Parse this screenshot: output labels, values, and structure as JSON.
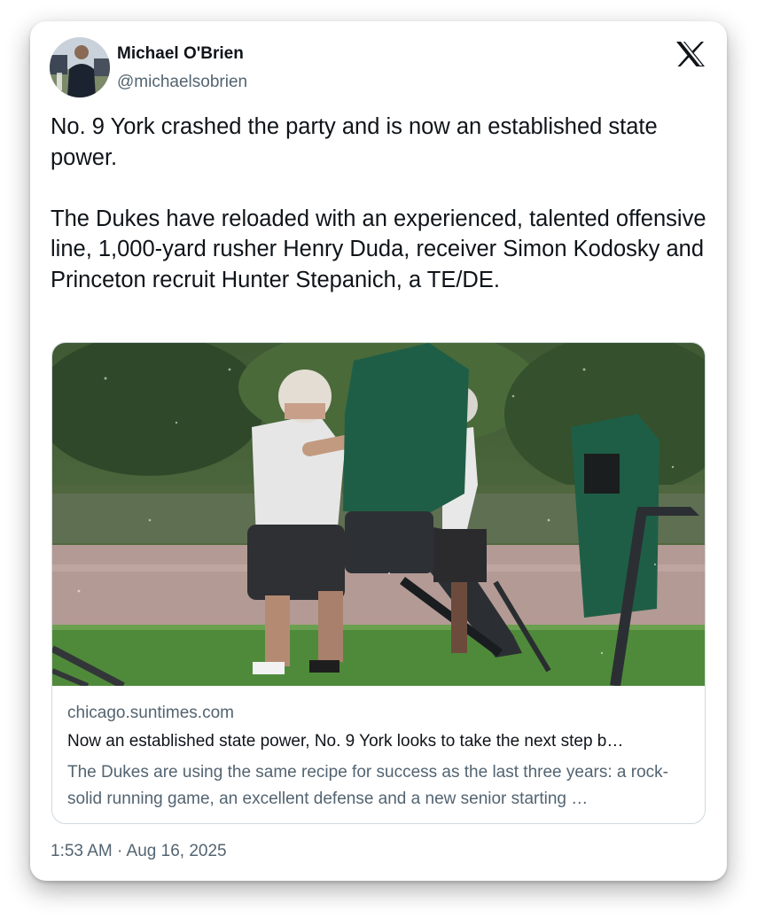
{
  "author": {
    "name": "Michael O'Brien",
    "handle": "@michaelsobrien",
    "avatar_icon": "person-avatar"
  },
  "platform_icon": "x-logo-icon",
  "tweet": {
    "paragraphs": [
      "No. 9 York crashed the party and is now an established state power.",
      "The Dukes have reloaded with an experienced, talented offensive line, 1,000-yard rusher Henry Duda, receiver Simon Kodosky and Princeton recruit Hunter Stepanich, a TE/DE."
    ]
  },
  "link_card": {
    "image_icon": "football-practice-photo",
    "domain": "chicago.suntimes.com",
    "title": "Now an established state power, No. 9 York looks to take the next step b…",
    "description": "The Dukes are using the same recipe for success as the last three years: a rock-solid running game, an excellent defense and a new senior starting …"
  },
  "timestamp": "1:53 AM · Aug 16, 2025",
  "colors": {
    "text_primary": "#0f1419",
    "text_secondary": "#536471",
    "border": "#cfd9de",
    "pad_green": "#1f5e46"
  }
}
